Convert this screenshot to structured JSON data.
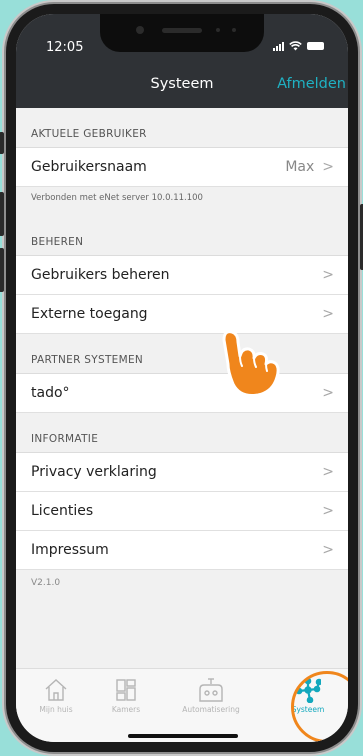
{
  "status_bar": {
    "time": "12:05"
  },
  "nav": {
    "title": "Systeem",
    "logout_label": "Afmelden"
  },
  "sections": {
    "current_user": {
      "header": "AKTUELE GEBRUIKER",
      "username_label": "Gebruikersnaam",
      "username_value": "Max",
      "connection_note": "Verbonden met eNet server 10.0.11.100"
    },
    "manage": {
      "header": "BEHEREN",
      "items": [
        {
          "label": "Gebruikers beheren"
        },
        {
          "label": "Externe toegang"
        }
      ]
    },
    "partners": {
      "header": "PARTNER SYSTEMEN",
      "items": [
        {
          "label": "tado°"
        }
      ]
    },
    "info": {
      "header": "INFORMATIE",
      "items": [
        {
          "label": "Privacy verklaring"
        },
        {
          "label": "Licenties"
        },
        {
          "label": "Impressum"
        }
      ]
    }
  },
  "version": "V2.1.0",
  "tabbar": {
    "tabs": [
      {
        "label": "Mijn huis",
        "icon": "house-icon",
        "active": false
      },
      {
        "label": "Kamers",
        "icon": "rooms-grid-icon",
        "active": false
      },
      {
        "label": "Automatisering",
        "icon": "robot-icon",
        "active": false
      },
      {
        "label": "Systeem",
        "icon": "network-icon",
        "active": true
      }
    ]
  },
  "colors": {
    "accent": "#1fb1c3",
    "nav_background": "#2f3236",
    "page_background": "#98dfd9",
    "highlight": "#f0861c"
  }
}
